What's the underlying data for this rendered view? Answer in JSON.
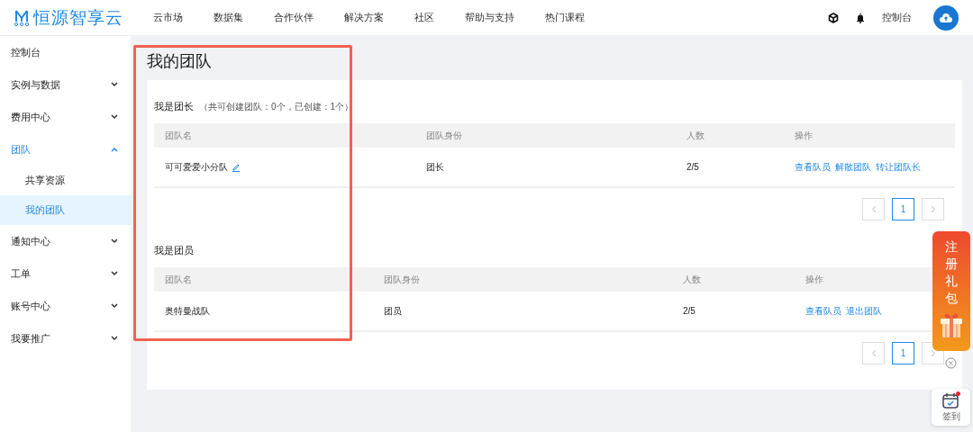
{
  "header": {
    "logo_text": "恒源智享云",
    "nav": [
      "云市场",
      "数据集",
      "合作伙伴",
      "解决方案",
      "社区",
      "帮助与支持",
      "热门课程"
    ],
    "console_link": "控制台"
  },
  "sidebar": {
    "items": [
      {
        "label": "控制台",
        "selected": false
      },
      {
        "label": "实例与数据",
        "selected": false,
        "expanded": false
      },
      {
        "label": "费用中心",
        "selected": false,
        "expanded": false
      },
      {
        "label": "团队",
        "selected": false,
        "expanded": true,
        "children": [
          {
            "label": "共享资源",
            "selected": false
          },
          {
            "label": "我的团队",
            "selected": true
          }
        ]
      },
      {
        "label": "通知中心",
        "selected": false,
        "expanded": false
      },
      {
        "label": "工单",
        "selected": false,
        "expanded": false
      },
      {
        "label": "账号中心",
        "selected": false,
        "expanded": false
      },
      {
        "label": "我要推广",
        "selected": false,
        "expanded": false
      }
    ]
  },
  "page_title": "我的团队",
  "sections": [
    {
      "title": "我是团长",
      "note": "（共可创建团队：0个，已创建：1个）",
      "columns": [
        "团队名",
        "团队身份",
        "人数",
        "操作"
      ],
      "rows": [
        {
          "name": "可可爱爱小分队",
          "editable": true,
          "role": "团长",
          "count": "2/5",
          "actions": [
            "查看队员",
            "解散团队",
            "转让团队长"
          ]
        }
      ],
      "pages": [
        {
          "label": "1",
          "selected": true
        }
      ]
    },
    {
      "title": "我是团员",
      "columns": [
        "团队名",
        "团队身份",
        "人数",
        "操作"
      ],
      "rows": [
        {
          "name": "奥特曼战队",
          "editable": false,
          "role": "团员",
          "count": "2/5",
          "actions": [
            "查看队员",
            "退出团队"
          ]
        }
      ],
      "pages": [
        {
          "label": "1",
          "selected": true
        }
      ]
    }
  ],
  "gift_banner": {
    "text": "注册礼包"
  },
  "checkin": {
    "label": "签到",
    "unread": true
  }
}
